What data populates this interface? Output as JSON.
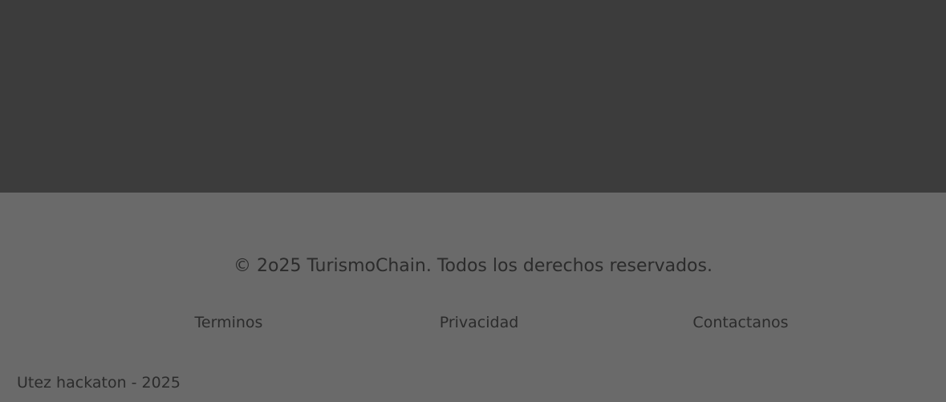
{
  "footer": {
    "copyright": "© 2o25 TurismoChain. Todos los derechos reservados.",
    "links": [
      {
        "label": "Terminos"
      },
      {
        "label": "Privacidad"
      },
      {
        "label": "Contactanos"
      }
    ],
    "event_note": "Utez hackaton - 2025"
  },
  "colors": {
    "top_background": "#3c3c3c",
    "footer_background": "#6a6a6a",
    "text": "#2b2b2b"
  }
}
